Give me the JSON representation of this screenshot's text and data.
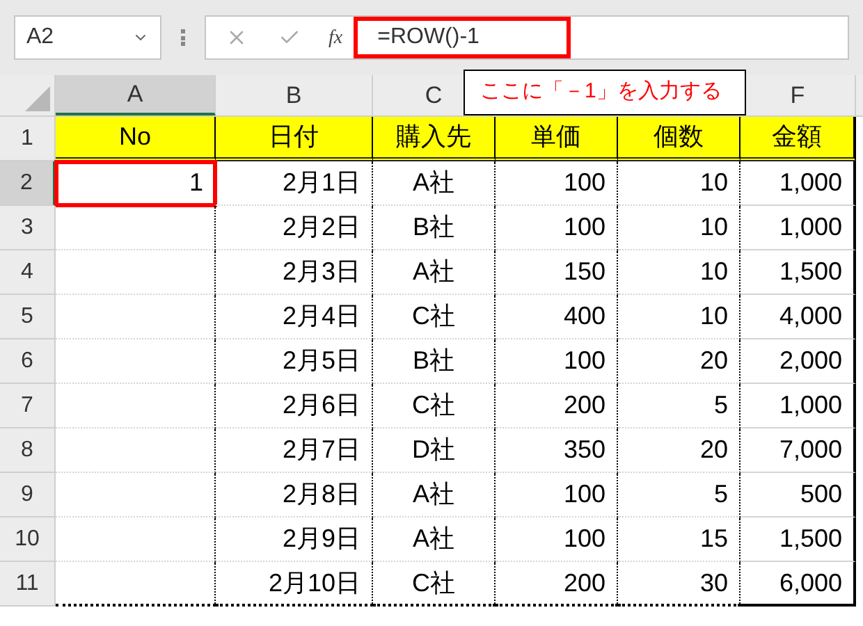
{
  "name_box": {
    "value": "A2"
  },
  "formula_bar": {
    "fx": "fx",
    "value": "=ROW()-1",
    "highlighted": true
  },
  "callout": {
    "text": "ここに「－1」を入力する"
  },
  "columns": [
    {
      "label": "A",
      "selected": true
    },
    {
      "label": "B",
      "selected": false
    },
    {
      "label": "C",
      "selected": false
    },
    {
      "label": "F",
      "selected": false
    }
  ],
  "rows": [
    {
      "number": "1",
      "kind": "header",
      "selected": false,
      "cells": [
        "No",
        "日付",
        "購入先",
        "単価",
        "個数",
        "金額"
      ]
    },
    {
      "number": "2",
      "kind": "data",
      "selected": true,
      "cells": [
        "1",
        "2月1日",
        "A社",
        "100",
        "10",
        "1,000"
      ]
    },
    {
      "number": "3",
      "kind": "data",
      "selected": false,
      "cells": [
        null,
        "2月2日",
        "B社",
        "100",
        "10",
        "1,000"
      ]
    },
    {
      "number": "4",
      "kind": "data",
      "selected": false,
      "cells": [
        null,
        "2月3日",
        "A社",
        "150",
        "10",
        "1,500"
      ]
    },
    {
      "number": "5",
      "kind": "data",
      "selected": false,
      "cells": [
        null,
        "2月4日",
        "C社",
        "400",
        "10",
        "4,000"
      ]
    },
    {
      "number": "6",
      "kind": "data",
      "selected": false,
      "cells": [
        null,
        "2月5日",
        "B社",
        "100",
        "20",
        "2,000"
      ]
    },
    {
      "number": "7",
      "kind": "data",
      "selected": false,
      "cells": [
        null,
        "2月6日",
        "C社",
        "200",
        "5",
        "1,000"
      ]
    },
    {
      "number": "8",
      "kind": "data",
      "selected": false,
      "cells": [
        null,
        "2月7日",
        "D社",
        "350",
        "20",
        "7,000"
      ]
    },
    {
      "number": "9",
      "kind": "data",
      "selected": false,
      "cells": [
        null,
        "2月8日",
        "A社",
        "100",
        "5",
        "500"
      ]
    },
    {
      "number": "10",
      "kind": "data",
      "selected": false,
      "cells": [
        null,
        "2月9日",
        "A社",
        "100",
        "15",
        "1,500"
      ]
    },
    {
      "number": "11",
      "kind": "data",
      "selected": false,
      "cells": [
        null,
        "2月10日",
        "C社",
        "200",
        "30",
        "6,000"
      ]
    }
  ]
}
